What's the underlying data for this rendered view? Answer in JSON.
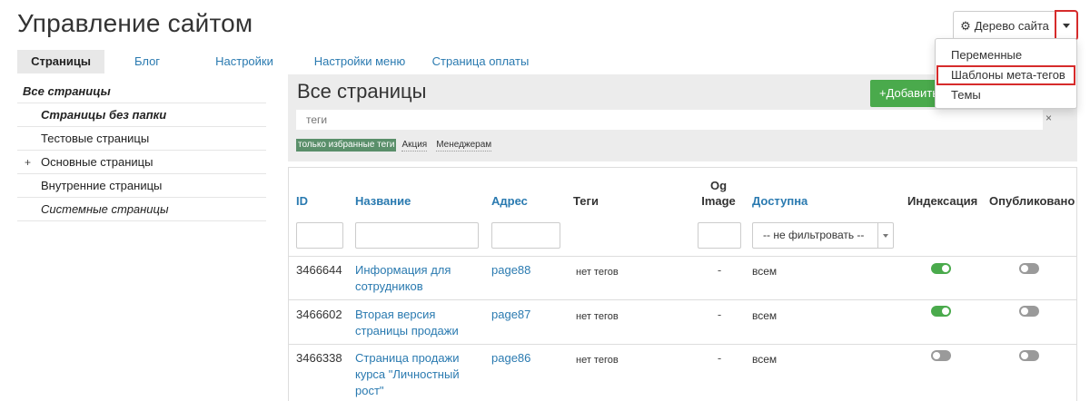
{
  "page": {
    "title": "Управление сайтом"
  },
  "tree_button": {
    "label": "Дерево сайта",
    "icon": "gear-icon"
  },
  "dropdown": {
    "items": [
      {
        "label": "Переменные"
      },
      {
        "label": "Шаблоны мета-тегов",
        "highlighted": true
      },
      {
        "label": "Темы"
      }
    ]
  },
  "tabs": [
    {
      "label": "Страницы",
      "active": true
    },
    {
      "label": "Блог"
    },
    {
      "label": "Настройки"
    },
    {
      "label": "Настройки меню"
    },
    {
      "label": "Страница оплаты"
    }
  ],
  "sidebar": {
    "items": [
      {
        "label": "Все страницы"
      },
      {
        "label": "Страницы без папки"
      },
      {
        "label": "Тестовые страницы"
      },
      {
        "label": "Основные страницы",
        "expand_symbol": "+"
      },
      {
        "label": "Внутренние страницы"
      },
      {
        "label": "Системные страницы"
      }
    ]
  },
  "main": {
    "title": "Все страницы",
    "add_button": "Добавить",
    "tags_placeholder": "теги",
    "tags_clear": "×",
    "tag_filters": [
      "только избранные теги",
      "Акция",
      "Менеджерам"
    ]
  },
  "table": {
    "headers": {
      "id": "ID",
      "name": "Название",
      "address": "Адрес",
      "tags": "Теги",
      "og_image": [
        "Og",
        "Image"
      ],
      "access": "Доступна",
      "indexing": "Индексация",
      "published": "Опубликовано"
    },
    "access_filter": "-- не фильтровать --",
    "rows": [
      {
        "id": "3466644",
        "name": "Информация для сотрудников",
        "address": "page88",
        "tags": "нет тегов",
        "og_image": "-",
        "access": "всем",
        "indexing": true,
        "published": false
      },
      {
        "id": "3466602",
        "name": "Вторая версия страницы продажи",
        "address": "page87",
        "tags": "нет тегов",
        "og_image": "-",
        "access": "всем",
        "indexing": true,
        "published": false
      },
      {
        "id": "3466338",
        "name": "Страница продажи курса \"Личностный рост\"",
        "address": "page86",
        "tags": "нет тегов",
        "og_image": "-",
        "access": "всем",
        "indexing": false,
        "published": false
      }
    ]
  },
  "colors": {
    "link": "#2a7ab0",
    "accent_green": "#4aaa4c",
    "highlight_red": "#d62b2b",
    "panel_gray": "#ececec"
  }
}
